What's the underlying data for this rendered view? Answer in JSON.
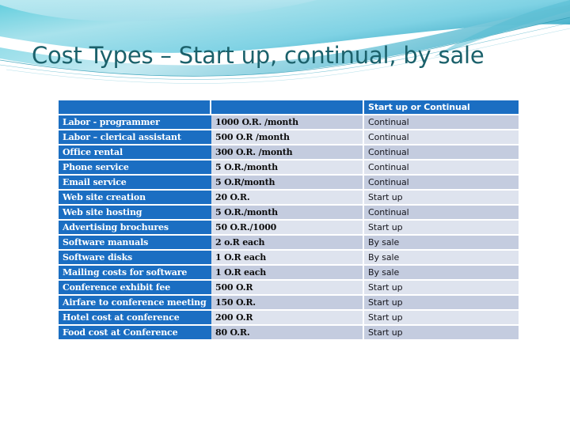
{
  "slide": {
    "title": "Cost Types – Start up, continual, by sale",
    "title_color": "#1b616b",
    "background_color": "#fdfdfd",
    "theme_accent_color": "#1b6ec2",
    "swoosh_colors": [
      "#3fb8cc",
      "#8fd9e6",
      "#c9ecf3",
      "#2a8fa8",
      "#ffffff"
    ]
  },
  "table": {
    "accent_color": "#1b6ec2",
    "band_a_color": "#c4ccdf",
    "band_b_color": "#dee3ee",
    "headers": [
      "",
      "",
      "Start up or Continual"
    ],
    "rows": [
      {
        "item": "Labor  - programmer",
        "cost": "1000 O.R. /month",
        "type": "Continual"
      },
      {
        "item": "Labor – clerical assistant",
        "cost": "500 O.R /month",
        "type": "Continual"
      },
      {
        "item": "Office rental",
        "cost": "300 O.R. /month",
        "type": "Continual"
      },
      {
        "item": "Phone service",
        "cost": "5 O.R./month",
        "type": "Continual"
      },
      {
        "item": "Email service",
        "cost": "5 O.R/month",
        "type": "Continual"
      },
      {
        "item": "Web site creation",
        "cost": "20 O.R.",
        "type": "Start up"
      },
      {
        "item": "Web site hosting",
        "cost": "5 O.R./month",
        "type": "Continual"
      },
      {
        "item": "Advertising brochures",
        "cost": "50 O.R./1000",
        "type": "Start up"
      },
      {
        "item": "Software manuals",
        "cost": "2 o.R each",
        "type": "By sale"
      },
      {
        "item": "Software disks",
        "cost": "1 O.R each",
        "type": "By sale"
      },
      {
        "item": "Mailing costs for software",
        "cost": "1 O.R each",
        "type": "By sale"
      },
      {
        "item": "Conference exhibit fee",
        "cost": "500 O.R",
        "type": "Start up"
      },
      {
        "item": "Airfare to conference meeting",
        "cost": "150 O.R.",
        "type": "Start up"
      },
      {
        "item": "Hotel cost at conference",
        "cost": "200 O.R",
        "type": "Start up"
      },
      {
        "item": "Food cost at Conference",
        "cost": "80 O.R.",
        "type": "Start up"
      }
    ]
  }
}
